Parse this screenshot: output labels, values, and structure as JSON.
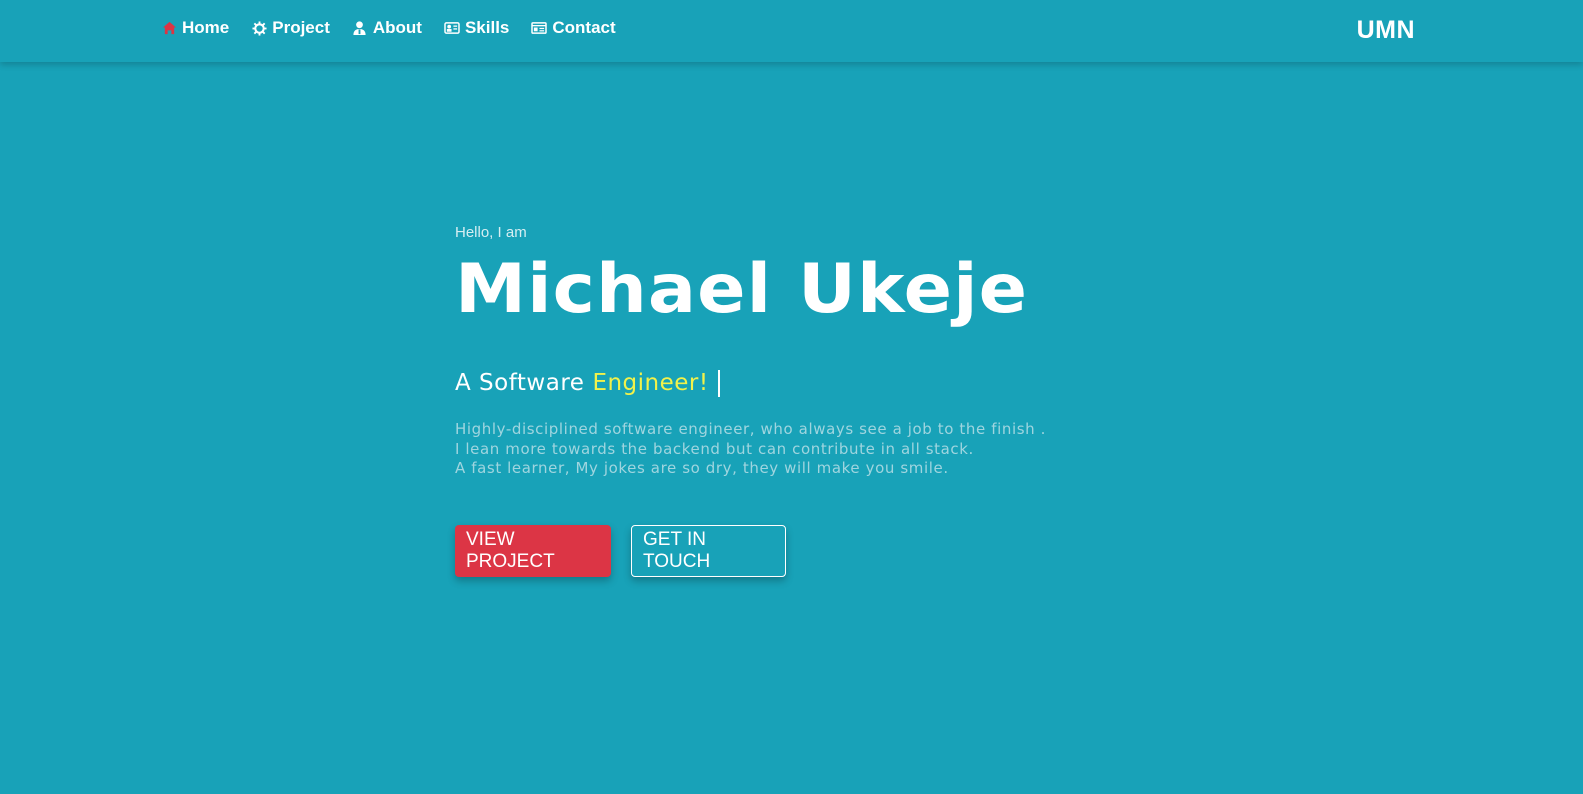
{
  "nav": {
    "items": [
      {
        "label": "Home",
        "icon": "home-icon",
        "icon_color": "#dc3545"
      },
      {
        "label": "Project",
        "icon": "gear-icon"
      },
      {
        "label": "About",
        "icon": "person-icon"
      },
      {
        "label": "Skills",
        "icon": "skills-icon"
      },
      {
        "label": "Contact",
        "icon": "contact-card-icon"
      }
    ],
    "brand": "UMN"
  },
  "hero": {
    "greeting": "Hello, I am",
    "name": "Michael Ukeje",
    "tagline_prefix": "A Software",
    "tagline_role": "Engineer!",
    "bio": [
      "Highly-disciplined software engineer, who always see a job to the finish .",
      "I lean more towards the backend but can contribute in all stack.",
      "A fast learner, My jokes are so dry, they will make you smile."
    ],
    "buttons": {
      "primary": "VIEW PROJECT",
      "secondary": "GET IN TOUCH"
    }
  },
  "colors": {
    "background": "#18a2b8",
    "accent_red": "#dc3545",
    "highlight_yellow": "#f2f24a"
  }
}
